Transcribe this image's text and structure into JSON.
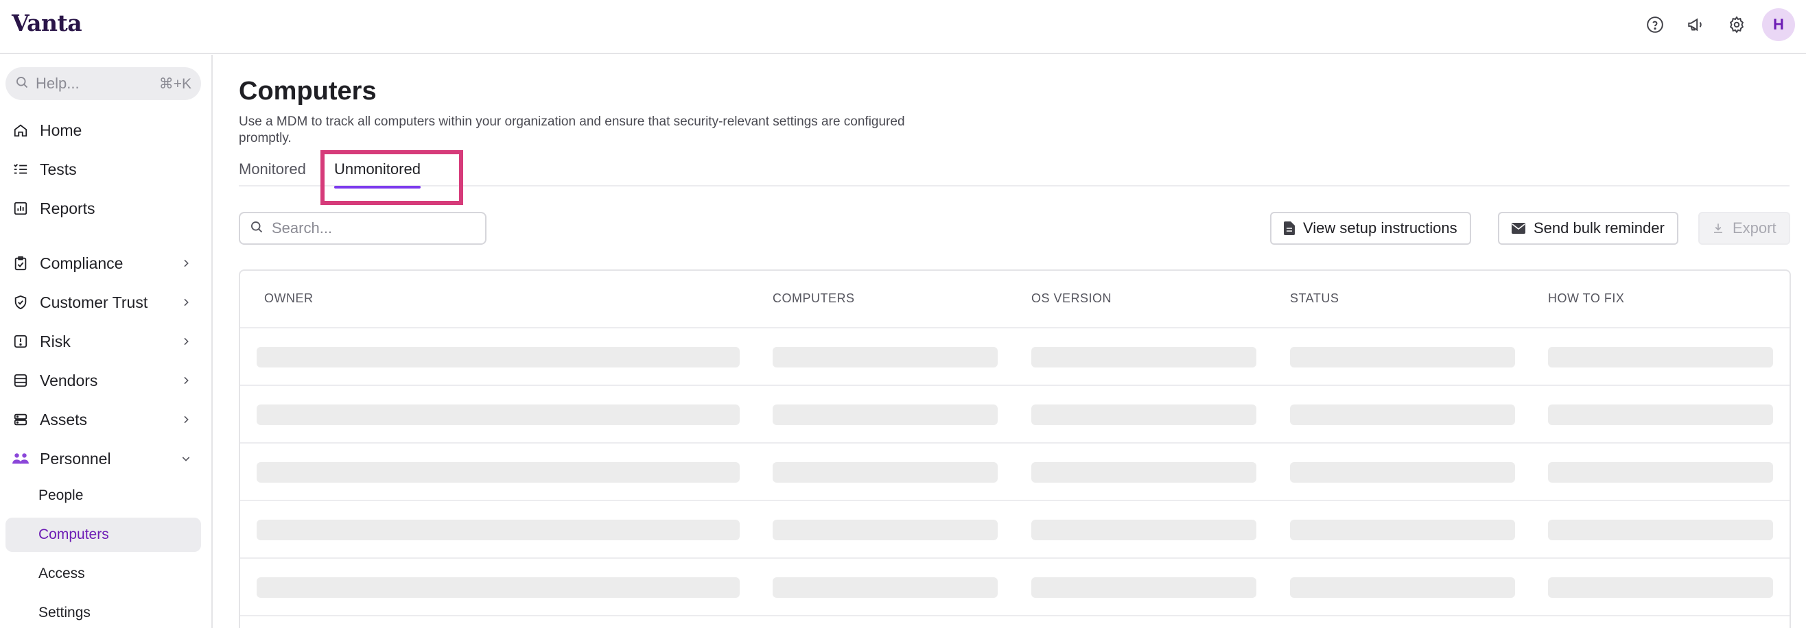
{
  "app": {
    "logo": "Vanta",
    "avatar_initial": "H"
  },
  "topbar": {
    "icons": [
      "help-circle-icon",
      "megaphone-icon",
      "gear-icon"
    ]
  },
  "sidebar": {
    "search_placeholder": "Help...",
    "search_shortcut": "⌘+K",
    "items": [
      {
        "label": "Home",
        "icon": "home-icon"
      },
      {
        "label": "Tests",
        "icon": "checklist-icon"
      },
      {
        "label": "Reports",
        "icon": "chart-icon"
      },
      {
        "label": "Compliance",
        "icon": "clipboard-icon"
      },
      {
        "label": "Customer Trust",
        "icon": "shield-icon"
      },
      {
        "label": "Risk",
        "icon": "alert-icon"
      },
      {
        "label": "Vendors",
        "icon": "database-icon"
      },
      {
        "label": "Assets",
        "icon": "server-icon"
      },
      {
        "label": "Personnel",
        "icon": "people-icon"
      }
    ],
    "personnel_subitems": [
      {
        "label": "People"
      },
      {
        "label": "Computers"
      },
      {
        "label": "Access"
      },
      {
        "label": "Settings"
      }
    ]
  },
  "main": {
    "title": "Computers",
    "description": "Use a MDM to track all computers within your organization and ensure that security-relevant settings are configured promptly.",
    "tabs": [
      {
        "label": "Monitored"
      },
      {
        "label": "Unmonitored"
      }
    ],
    "active_tab": "Unmonitored",
    "search_placeholder": "Search...",
    "buttons": {
      "setup": "View setup instructions",
      "reminder": "Send bulk reminder",
      "export": "Export"
    },
    "table": {
      "columns": [
        "OWNER",
        "COMPUTERS",
        "OS VERSION",
        "STATUS",
        "HOW TO FIX"
      ],
      "loading_rows": 5
    }
  },
  "colors": {
    "accent": "#7c3aed",
    "active_nav_text": "#6d1db5",
    "highlight": "#d63b7a",
    "avatar_bg": "#ead7f5"
  }
}
